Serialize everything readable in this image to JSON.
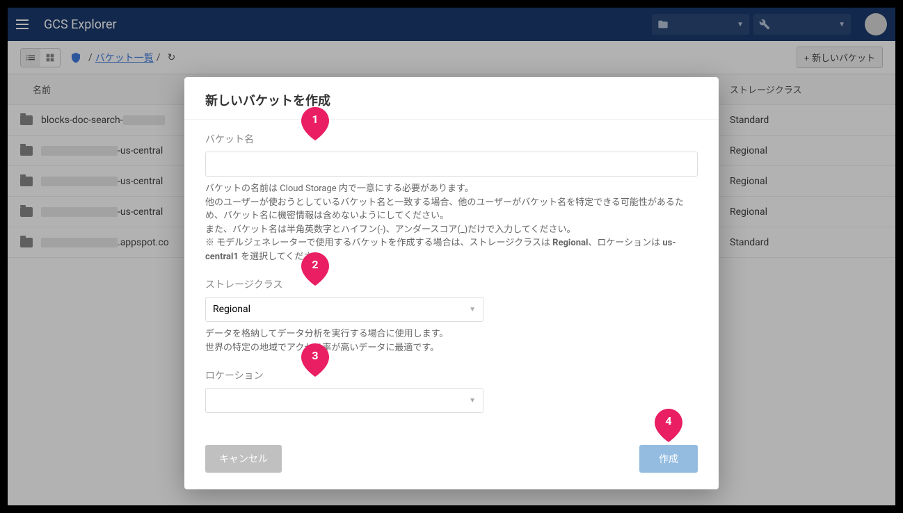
{
  "header": {
    "app_title": "GCS Explorer"
  },
  "toolbar": {
    "breadcrumb_link": "バケット一覧",
    "new_bucket_label": "新しいバケット"
  },
  "table": {
    "columns": {
      "name": "名前",
      "storage_class": "ストレージクラス"
    },
    "rows": [
      {
        "name_prefix": "blocks-doc-search-",
        "name_suffix": "",
        "storage_class": "Standard"
      },
      {
        "name_prefix": "",
        "name_suffix": "-us-central",
        "storage_class": "Regional"
      },
      {
        "name_prefix": "",
        "name_suffix": "-us-central",
        "storage_class": "Regional"
      },
      {
        "name_prefix": "",
        "name_suffix": "-us-central",
        "storage_class": "Regional"
      },
      {
        "name_prefix": "",
        "name_suffix": ".appspot.co",
        "storage_class": "Standard"
      }
    ]
  },
  "modal": {
    "title": "新しいバケットを作成",
    "bucket_name": {
      "label": "バケット名",
      "value": "",
      "help1": "バケットの名前は Cloud Storage 内で一意にする必要があります。",
      "help2": "他のユーザーが使おうとしているバケット名と一致する場合、他のユーザーがバケット名を特定できる可能性があるため、バケット名に機密情報は含めないようにしてください。",
      "help3": "また、バケット名は半角英数字とハイフン(-)、アンダースコア(_)だけで入力してください。",
      "help4_pre": "※ モデルジェネレーターで使用するバケットを作成する場合は、ストレージクラスは ",
      "help4_b1": "Regional",
      "help4_mid": "、ロケーションは ",
      "help4_b2": "us-central1",
      "help4_post": " を選択してください。"
    },
    "storage_class": {
      "label": "ストレージクラス",
      "selected": "Regional",
      "help1": "データを格納してデータ分析を実行する場合に使用します。",
      "help2": "世界の特定の地域でアクセス率が高いデータに最適です。"
    },
    "location": {
      "label": "ロケーション",
      "selected": ""
    },
    "cancel_label": "キャンセル",
    "create_label": "作成"
  },
  "pins": [
    "1",
    "2",
    "3",
    "4"
  ]
}
